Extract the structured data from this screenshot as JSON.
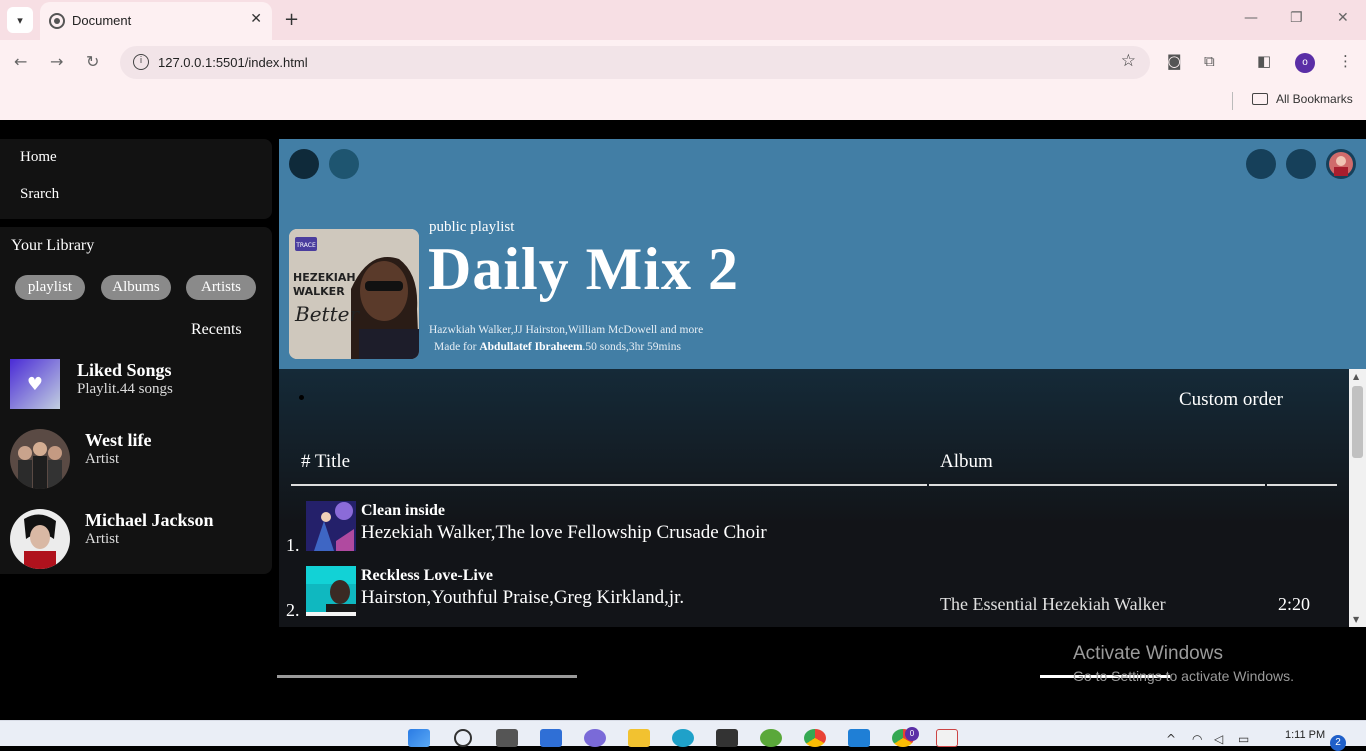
{
  "browser": {
    "tab_title": "Document",
    "url": "127.0.0.1:5501/index.html",
    "bookmarks_label": "All Bookmarks",
    "profile_initial": "o"
  },
  "nav": {
    "home": "Home",
    "search": "Srarch"
  },
  "library": {
    "title": "Your Library",
    "chips": [
      "playlist",
      "Albums",
      "Artists"
    ],
    "recents": "Recents",
    "items": [
      {
        "title": "Liked Songs",
        "subtitle": "Playlit.44 songs",
        "icon": "heart-icon"
      },
      {
        "title": "West life",
        "subtitle": "Artist"
      },
      {
        "title": "Michael Jackson",
        "subtitle": "Artist"
      }
    ]
  },
  "playlist": {
    "label": "public playlist",
    "title": "Daily Mix 2",
    "description": "Hazwkiah Walker,JJ Hairston,William McDowell and more",
    "made_for_prefix": "Made for",
    "made_for_user": "Abdullatef Ibraheem",
    "stats": ".50 sonds,3hr 59mins",
    "cover_text": {
      "badge": "TRACE",
      "line1": "HEZEKIAH",
      "line2": "WALKER",
      "line3": "Better"
    }
  },
  "tracklist": {
    "custom_order": "Custom order",
    "col_title": "# Title",
    "col_album": "Album",
    "rows": [
      {
        "num": "1.",
        "title": "Clean inside",
        "artist": "Hezekiah Walker,The love Fellowship Crusade Choir",
        "album": "",
        "duration": ""
      },
      {
        "num": "2.",
        "title": "Reckless Love-Live",
        "artist": "Hairston,Youthful Praise,Greg Kirkland,jr.",
        "album": "The Essential Hezekiah Walker",
        "duration": "2:20"
      }
    ]
  },
  "watermark": {
    "title": "Activate Windows",
    "subtitle": "Go to Settings to activate Windows."
  },
  "taskbar": {
    "time": "1:11 PM",
    "notifications": "2",
    "badge": "0"
  },
  "colors": {
    "hero": "#427ea5",
    "panel": "#121212",
    "chip": "#8a8a8a"
  }
}
